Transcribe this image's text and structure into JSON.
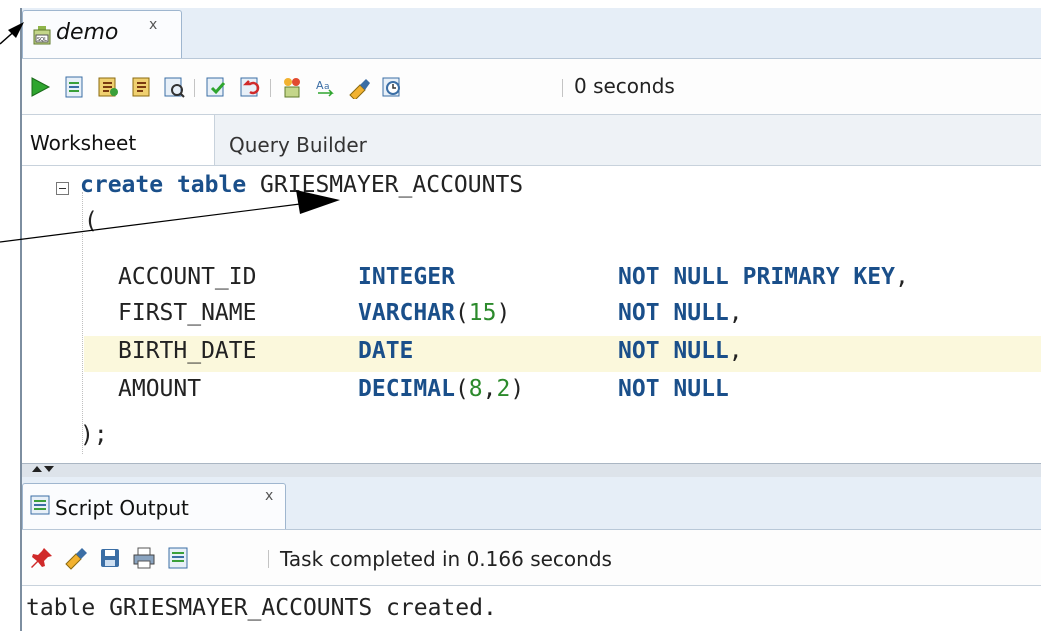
{
  "editor_tab": {
    "label": "demo",
    "close": "x",
    "icon": "sql-worksheet-icon"
  },
  "toolbar": {
    "icons": [
      "run-statement-icon",
      "run-script-icon",
      "autotrace-icon",
      "explain-plan-icon",
      "sql-tuning-icon",
      "commit-icon",
      "rollback-icon",
      "unshared-sql-icon",
      "to-upper-lower-icon",
      "clear-icon",
      "sql-history-icon"
    ],
    "elapsed": "0 seconds"
  },
  "subtabs": {
    "worksheet": "Worksheet",
    "query_builder": "Query Builder"
  },
  "code": {
    "line1": {
      "kw1": "create",
      "kw2": "table",
      "name": " GRIESMAYER_ACCOUNTS"
    },
    "line2": "(",
    "rows": [
      {
        "col": "ACCOUNT_ID",
        "type": "INTEGER",
        "args": "",
        "constraint": "NOT NULL PRIMARY KEY",
        "punct": ","
      },
      {
        "col": "FIRST_NAME",
        "type": "VARCHAR",
        "args": "15",
        "constraint": "NOT NULL",
        "punct": ","
      },
      {
        "col": "BIRTH_DATE",
        "type": "DATE",
        "args": "",
        "constraint": "NOT NULL",
        "punct": ","
      },
      {
        "col": "AMOUNT",
        "type": "DECIMAL",
        "args": "8,2",
        "constraint": "NOT NULL",
        "punct": ""
      }
    ],
    "last_line": ");"
  },
  "output_tab": {
    "label": "Script Output",
    "close": "x",
    "icon": "script-output-icon"
  },
  "output_toolbar": {
    "icons": [
      "pin-icon",
      "clear-icon",
      "save-icon",
      "print-icon",
      "script-icon"
    ],
    "status": "Task completed in 0.166 seconds"
  },
  "output_text": "table GRIESMAYER_ACCOUNTS created.",
  "colors": {
    "keyword": "#1a4f8a",
    "number": "#2c8a2c",
    "highlight_line": "#fbf8dc",
    "tab_strip": "#e6eef7"
  }
}
